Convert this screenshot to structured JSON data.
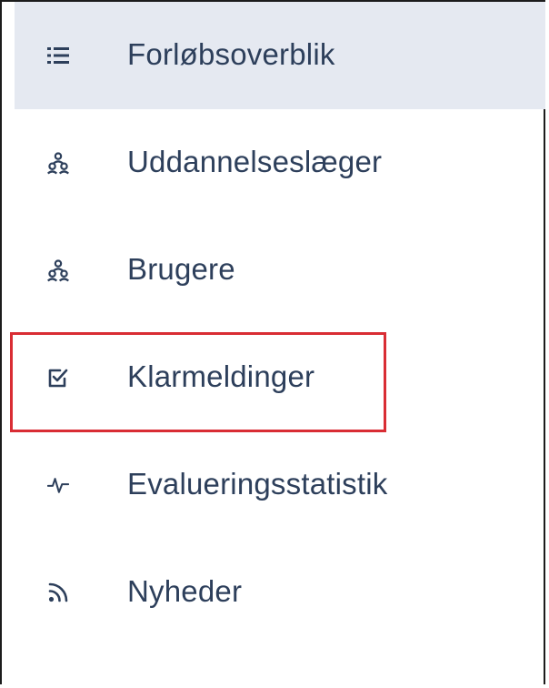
{
  "sidebar": {
    "items": [
      {
        "label": "Forløbsoverblik",
        "icon": "list-icon",
        "active": true
      },
      {
        "label": "Uddannelseslæger",
        "icon": "users-icon",
        "active": false
      },
      {
        "label": "Brugere",
        "icon": "users-icon",
        "active": false
      },
      {
        "label": "Klarmeldinger",
        "icon": "checkbox-icon",
        "active": false
      },
      {
        "label": "Evalueringsstatistik",
        "icon": "activity-icon",
        "active": false
      },
      {
        "label": "Nyheder",
        "icon": "rss-icon",
        "active": false
      }
    ]
  },
  "colors": {
    "active_bg": "#e5e9f1",
    "text": "#2d3f5b",
    "icon": "#2d3f5b",
    "highlight": "#d92d34"
  }
}
